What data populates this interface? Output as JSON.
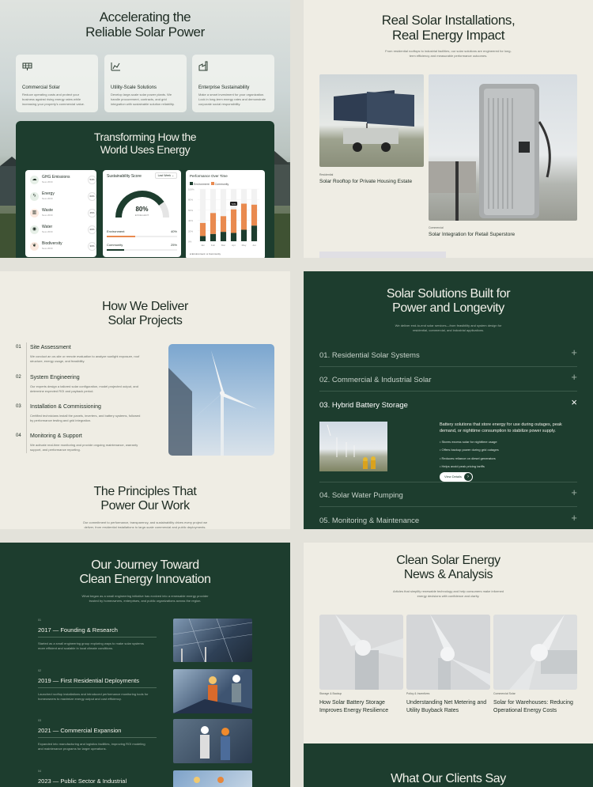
{
  "hero": {
    "title_l1": "Accelerating the",
    "title_l2": "Reliable Solar Power",
    "cards": [
      {
        "icon": "solar-panel-icon",
        "title": "Commercial Solar",
        "desc": "Reduce operating costs and protect your business against rising energy rates while increasing your property's commercial value."
      },
      {
        "icon": "factory-chart-icon",
        "title": "Utility-Scale Solutions",
        "desc": "Develop large-scale solar power plants. We handle procurement, contracts, and grid integration with sustainable solution reliability."
      },
      {
        "icon": "industry-icon",
        "title": "Enterprise Sustainability",
        "desc": "Make a smart investment for your organization. Lock in long-term energy rates and demonstrate corporate social responsibility."
      }
    ],
    "dashboard": {
      "title_l1": "Transforming How the",
      "title_l2": "World Uses Energy",
      "emissions": [
        {
          "icon": "co2-icon",
          "name": "GHG Emissions",
          "sub": "New 2030",
          "pct": "54%"
        },
        {
          "icon": "bolt-icon",
          "name": "Energy",
          "sub": "New 2030",
          "pct": "60%"
        },
        {
          "icon": "trash-icon",
          "name": "Waste",
          "sub": "New 2030",
          "pct": "45%"
        },
        {
          "icon": "drop-icon",
          "name": "Water",
          "sub": "New 2030",
          "pct": "20%"
        },
        {
          "icon": "leaf-icon",
          "name": "Biodiversity",
          "sub": "New 2030",
          "pct": "30%"
        }
      ],
      "score": {
        "title": "Sustainability Score",
        "filter": "Last Week",
        "value": "80%",
        "label": "EXCELLENT",
        "level": 0.8,
        "rows": [
          {
            "name": "Environment",
            "pct": "40%",
            "level": 0.4
          },
          {
            "name": "Community",
            "pct": "25%",
            "level": 0.25
          }
        ]
      },
      "performance": {
        "title": "Performance Over Time",
        "legend": [
          "Environment",
          "Community"
        ],
        "tooltip": "72%",
        "y_ticks": [
          "100%",
          "80%",
          "60%",
          "40%",
          "20%",
          "0%"
        ],
        "x_ticks": [
          "Jan",
          "Feb",
          "Mar",
          "Apr",
          "May",
          "Jun"
        ],
        "bars": [
          {
            "env": 10,
            "com": 25
          },
          {
            "env": 14,
            "com": 40
          },
          {
            "env": 18,
            "com": 30
          },
          {
            "env": 16,
            "com": 45
          },
          {
            "env": 22,
            "com": 50
          },
          {
            "env": 30,
            "com": 40
          }
        ],
        "footer": [
          "Environment",
          "Community"
        ]
      }
    }
  },
  "installations": {
    "title_l1": "Real Solar Installations,",
    "title_l2": "Real Energy Impact",
    "sub": "From residential rooftops to industrial facilities, our solar solutions are engineered for long-term efficiency and measurable performance outcomes.",
    "items": [
      {
        "category": "Residential",
        "title": "Solar Rooftop for Private Housing Estate"
      },
      {
        "category": "Commercial",
        "title": "Solar Integration for Retail Superstore"
      }
    ]
  },
  "process": {
    "title_l1": "How We Deliver",
    "title_l2": "Solar Projects",
    "steps": [
      {
        "num": "01",
        "title": "Site Assessment",
        "desc": "We conduct an on-site or remote evaluation to analyze sunlight exposure, roof structure, energy usage, and feasibility."
      },
      {
        "num": "02",
        "title": "System Engineering",
        "desc": "Our experts design a tailored solar configuration, model projected output, and determine expected ROI and payback period."
      },
      {
        "num": "03",
        "title": "Installation & Commissioning",
        "desc": "Certified technicians install the panels, inverters, and battery systems, followed by performance testing and grid integration."
      },
      {
        "num": "04",
        "title": "Monitoring & Support",
        "desc": "We activate real-time monitoring and provide ongoing maintenance, warranty support, and performance reporting."
      }
    ],
    "principles_l1": "The Principles That",
    "principles_l2": "Power Our Work",
    "principles_sub": "Our commitment to performance, transparency, and sustainability drives every project we deliver, from residential installations to large-scale commercial and public deployments."
  },
  "solutions": {
    "title_l1": "Solar Solutions Built for",
    "title_l2": "Power and Longevity",
    "sub": "We deliver end-to-end solar services—from feasibility and system design for residential, commercial, and industrial applications.",
    "items": [
      {
        "label": "01.  Residential Solar Systems",
        "icon": "+"
      },
      {
        "label": "02.  Commercial & Industrial Solar",
        "icon": "+"
      },
      {
        "label": "03.  Hybrid Battery Storage",
        "icon": "×"
      },
      {
        "label": "04.  Solar Water Pumping",
        "icon": "+"
      },
      {
        "label": "05.  Monitoring & Maintenance",
        "icon": "+"
      }
    ],
    "open": {
      "desc": "Battery solutions that store energy for use during outages, peak demand, or nighttime consumption to stabilize power supply.",
      "bullets": [
        "Stores excess solar for nighttime usage",
        "Offers backup power during grid outages",
        "Reduces reliance on diesel generators",
        "Helps avoid peak pricing tariffs"
      ],
      "button": "View Details"
    }
  },
  "journey": {
    "title_l1": "Our Journey Toward",
    "title_l2": "Clean Energy Innovation",
    "sub": "What began as a small engineering initiative has evolved into a renewable energy provider trusted by homeowners, enterprises, and public organizations across the region.",
    "items": [
      {
        "idx": "01",
        "title": "2017 — Founding & Research",
        "desc": "Started as a small engineering group exploring ways to make solar systems more efficient and scalable in local climate conditions."
      },
      {
        "idx": "02",
        "title": "2019 — First Residential Deployments",
        "desc": "Launched rooftop installations and introduced performance monitoring tools for homeowners to maximize energy output and cost efficiency."
      },
      {
        "idx": "03",
        "title": "2021 — Commercial Expansion",
        "desc": "Expanded into manufacturing and logistics facilities, improving ROI modeling and maintenance programs for larger operations."
      },
      {
        "idx": "04",
        "title": "2023 — Public Sector & Industrial",
        "desc": ""
      }
    ]
  },
  "news": {
    "title_l1": "Clean Solar Energy",
    "title_l2": "News & Analysis",
    "sub": "Articles that simplify renewable technology and help consumers make informed energy decisions with confidence and clarity.",
    "items": [
      {
        "category": "Storage & Backup",
        "title": "How Solar Battery Storage Improves Energy Resilience"
      },
      {
        "category": "Policy & Incentives",
        "title": "Understanding Net Metering and Utility Buyback Rates"
      },
      {
        "category": "Commercial Solar",
        "title": "Solar for Warehouses: Reducing Operational Energy Costs"
      }
    ],
    "clients_title": "What Our Clients Say"
  },
  "colors": {
    "green": "#1d3d2e",
    "cream": "#efede4",
    "orange": "#e98a4f",
    "accent_dark": "#1d3d2e"
  }
}
